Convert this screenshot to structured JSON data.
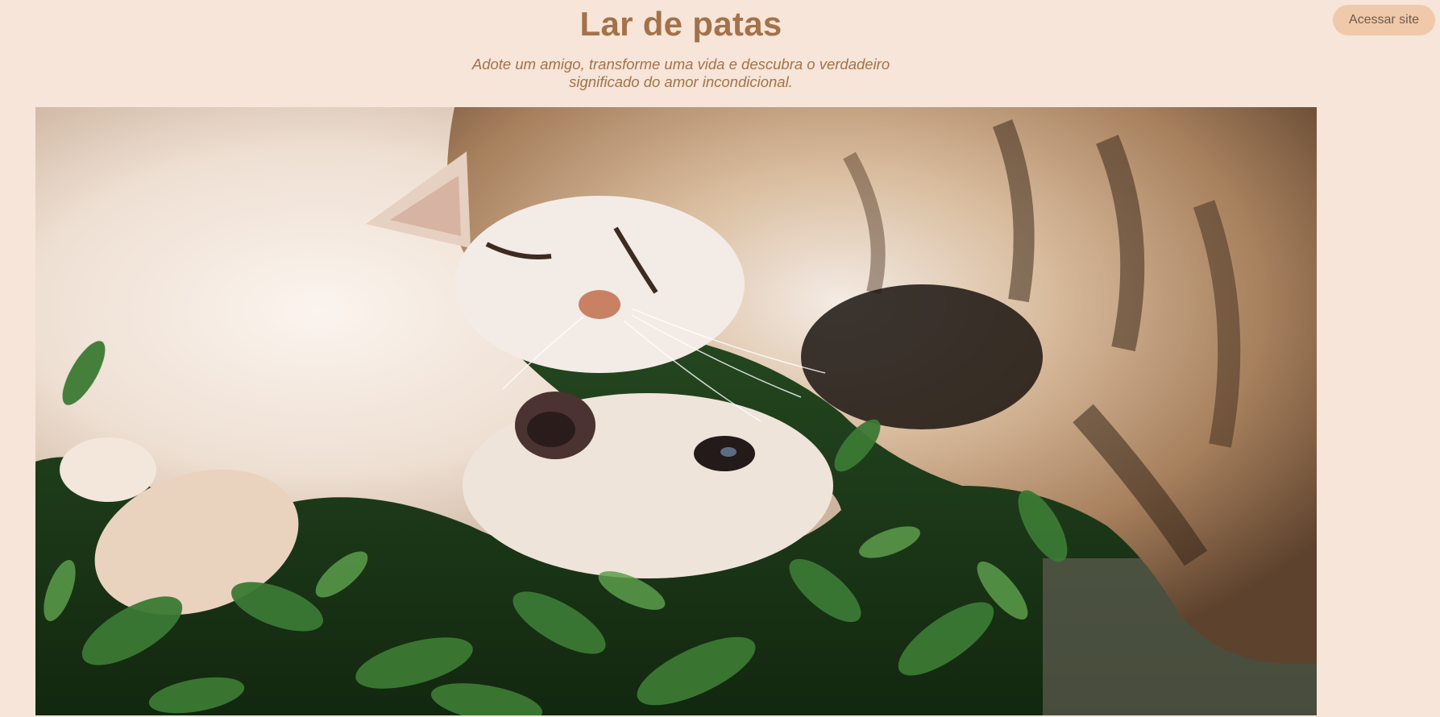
{
  "header": {
    "title": "Lar de patas",
    "subtitle_line1": "Adote um amigo, transforme uma vida e descubra o verdadeiro",
    "subtitle_line2": "significado do amor incondicional.",
    "access_button_label": "Acessar site"
  },
  "hero": {
    "image_subject": "cat-and-dog-photo"
  },
  "colors": {
    "background": "#f6e5d8",
    "accent_text": "#a3724a",
    "button_bg": "#f0c9aa",
    "button_text": "#6e5a4b"
  }
}
